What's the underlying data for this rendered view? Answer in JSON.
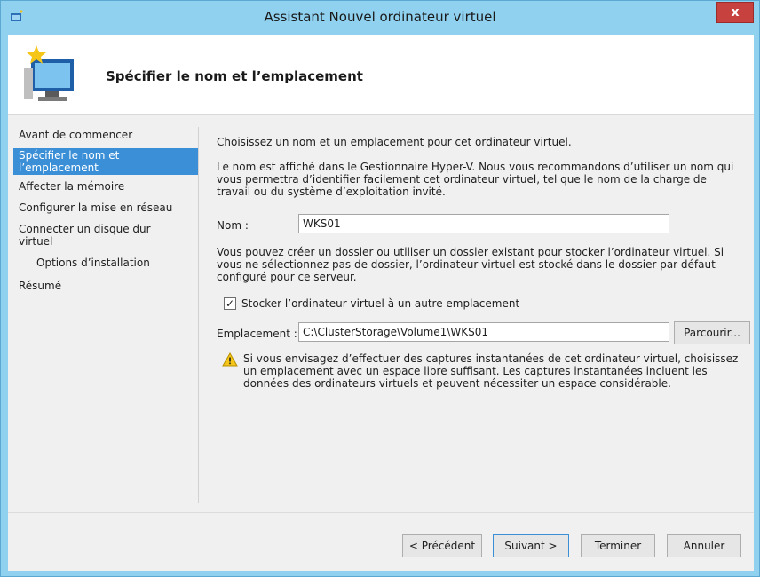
{
  "window": {
    "title": "Assistant Nouvel ordinateur virtuel",
    "close_label": "x"
  },
  "header": {
    "title": "Spécifier le nom et l’emplacement",
    "icon": "hyperv-vm-wizard-icon"
  },
  "nav": {
    "items": [
      {
        "label": "Avant de commencer",
        "active": false
      },
      {
        "label": "Spécifier le nom et l’emplacement",
        "active": true
      },
      {
        "label": "Affecter la mémoire",
        "active": false
      },
      {
        "label": "Configurer la mise en réseau",
        "active": false
      },
      {
        "label": "Connecter un disque dur virtuel",
        "active": false
      },
      {
        "label": "Options d’installation",
        "active": false
      },
      {
        "label": "Résumé",
        "active": false
      }
    ]
  },
  "content": {
    "intro": "Choisissez un nom et un emplacement pour cet ordinateur virtuel.",
    "description": "Le nom est affiché dans le Gestionnaire Hyper-V. Nous vous recommandons d’utiliser un nom qui vous permettra d’identifier facilement cet ordinateur virtuel, tel que le nom de la charge de travail ou du système d’exploitation invité.",
    "name_label": "Nom :",
    "name_value": "WKS01",
    "folder_text": "Vous pouvez créer un dossier ou utiliser un dossier existant pour stocker l’ordinateur virtuel. Si vous ne sélectionnez pas de dossier, l’ordinateur virtuel est stocké dans le dossier par défaut configuré pour ce serveur.",
    "store_checkbox_label": "Stocker l’ordinateur virtuel à un autre emplacement",
    "store_checked": true,
    "location_label": "Emplacement :",
    "location_value": "C:\\ClusterStorage\\Volume1\\WKS01",
    "browse_label": "Parcourir...",
    "warning_text": "Si vous envisagez d’effectuer des captures instantanées de cet ordinateur virtuel, choisissez un emplacement avec un espace libre suffisant. Les captures instantanées incluent les données des ordinateurs virtuels et peuvent nécessiter un espace considérable."
  },
  "footer": {
    "previous_label": "< Précédent",
    "next_label": "Suivant >",
    "finish_label": "Terminer",
    "cancel_label": "Annuler"
  },
  "colors": {
    "title_bar": "#8fd1ef",
    "active_nav": "#3a8fd7",
    "close_button": "#c7413f",
    "warning_yellow": "#f5c518"
  }
}
